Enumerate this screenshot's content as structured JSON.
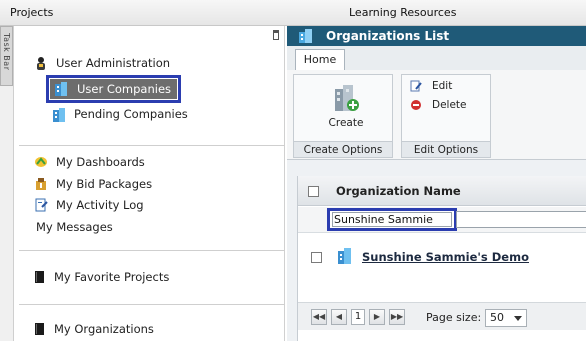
{
  "topbar": {
    "projects": "Projects",
    "learning": "Learning Resources"
  },
  "taskbar": {
    "label": "Task Bar"
  },
  "nav": {
    "user_admin": "User Administration",
    "user_companies": "User Companies",
    "pending_companies": "Pending Companies",
    "my_dashboards": "My Dashboards",
    "my_bid_packages": "My Bid Packages",
    "my_activity_log": "My Activity Log",
    "my_messages": "My Messages",
    "my_favorite_projects": "My Favorite Projects",
    "my_organizations": "My Organizations"
  },
  "org": {
    "title": "Organizations List",
    "home_tab": "Home",
    "create": "Create",
    "create_group": "Create Options",
    "edit": "Edit",
    "delete": "Delete",
    "edit_group": "Edit Options",
    "col_name": "Organization Name",
    "filter_value": "Sunshine Sammie",
    "row_name": "Sunshine Sammie's Demo",
    "page_current": "1",
    "page_size_label": "Page size:",
    "page_size_value": "50"
  },
  "colors": {
    "header": "#1f5a78",
    "highlight": "#2b3db0"
  }
}
